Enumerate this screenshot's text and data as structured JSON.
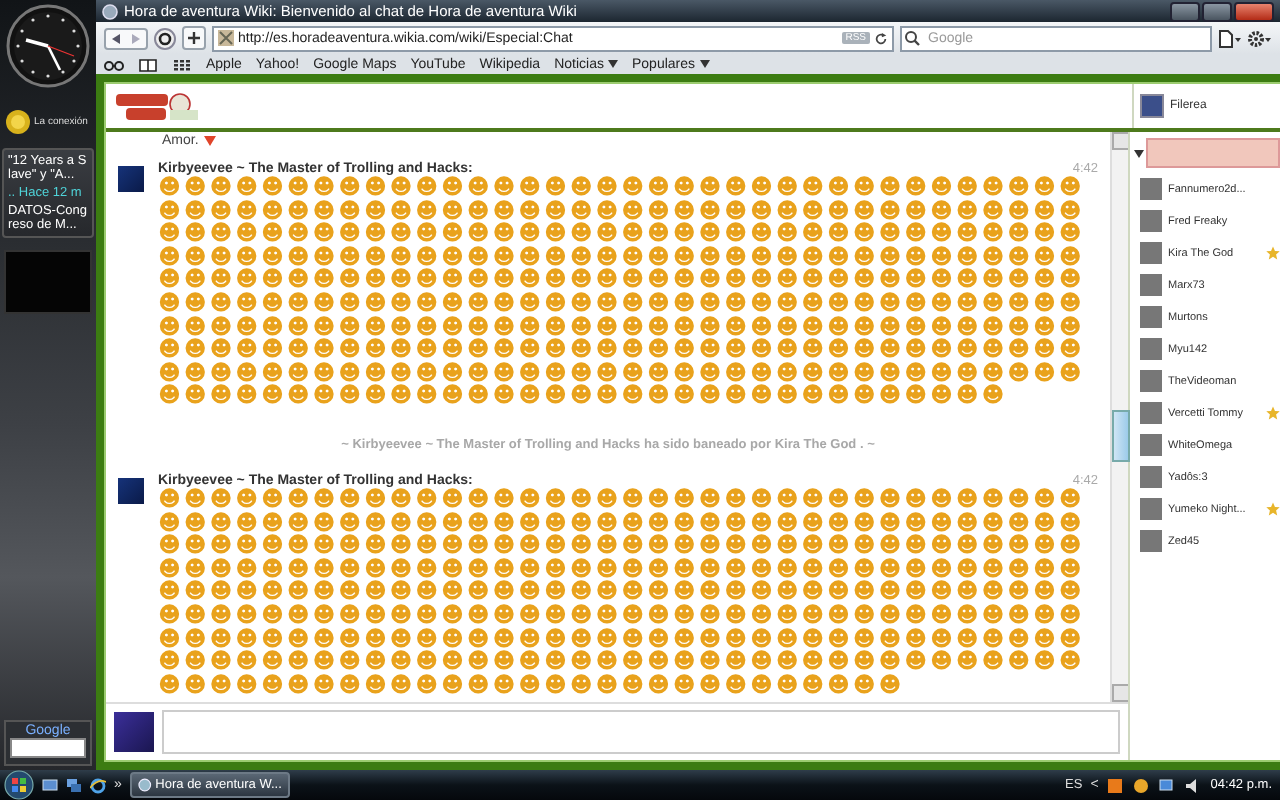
{
  "sidebar": {
    "weather": {
      "label": "La conexión"
    },
    "news": [
      {
        "headline": "\"12 Years a Slave\" y \"A...",
        "time": ".. Hace 12 m"
      },
      {
        "headline": "DATOS-Congreso de M..."
      }
    ],
    "google": {
      "label": "Google"
    }
  },
  "window": {
    "title": "Hora de aventura Wiki: Bienvenido al chat de Hora de aventura Wiki"
  },
  "toolbar": {
    "url": "http://es.horadeaventura.wikia.com/wiki/Especial:Chat",
    "rss": "RSS",
    "search": {
      "placeholder": "Google"
    }
  },
  "bookmarks": [
    {
      "label": "Apple",
      "menu": false
    },
    {
      "label": "Yahoo!",
      "menu": false
    },
    {
      "label": "Google Maps",
      "menu": false
    },
    {
      "label": "YouTube",
      "menu": false
    },
    {
      "label": "Wikipedia",
      "menu": false
    },
    {
      "label": "Noticias",
      "menu": true
    },
    {
      "label": "Populares",
      "menu": true
    }
  ],
  "chat": {
    "header": {
      "user": "Filerea"
    },
    "messages": [
      {
        "kind": "fragment",
        "text": "Amor."
      },
      {
        "kind": "message",
        "user": "Kirbyeevee ~ The Master of Trolling and Hacks:",
        "time": "4:42",
        "emoticons": "☻☻☻☻☻☻☻☻☻☻☻☻☻☻☻☻☻☻☻☻☻☻☻☻☻☻☻☻☻☻☻☻☻☻☻☻☻☻☻☻☻☻☻☻☻☻☻☻☻☻☻☻☻☻☻☻☻☻☻☻☻☻☻☻☻☻☻☻☻☻☻☻☻☻☻☻☻☻☻☻☻☻☻☻☻☻☻☻☻☻☻☻☻☻☻☻☻☻☻☻☻☻☻☻☻☻☻☻☻☻☻☻☻☻☻☻☻☻☻☻☻☻☻☻☻☻☻☻☻☻☻☻☻☻☻☻☻☻☻☻☻☻☻☻☻☻☻☻☻☻☻☻☻☻☻☻☻☻☻☻☻☻☻☻☻☻☻☻☻☻☻☻☻☻☻☻☻☻☻☻☻☻☻☻☻☻☻☻☻☻☻☻☻☻☻☻☻☻☻☻☻☻☻☻☻☻☻☻☻☻☻☻☻☻☻☻☻☻☻☻☻☻☻☻☻☻☻☻☻☻☻☻☻☻☻☻☻☻☻☻☻☻☻☻☻☻☻☻☻☻☻☻☻☻☻☻☻☻☻☻☻☻☻☻☻☻☻☻☻☻☻☻☻☻☻☻☻☻☻☻☻☻☻☻☻☻☻☻☻☻☻☻☻☻☻☻☻☻☻☻☻☻☻☻☻☻☻☻☻☻☻☻☻☻☻☻☻☻☻☻☻☻☻☻☻☻☻☻☻☻☻☻☻☻☻☻☻☻☻☻☻☻☻☻☻☻☻☻☻☻☻☻☻☻☻☻☻"
      },
      {
        "kind": "alert",
        "text": "~ Kirbyeevee ~ The Master of Trolling and Hacks ha sido baneado por Kira The God . ~"
      },
      {
        "kind": "message",
        "user": "Kirbyeevee ~ The Master of Trolling and Hacks:",
        "time": "4:42",
        "emoticons": "☻☻☻☻☻☻☻☻☻☻☻☻☻☻☻☻☻☻☻☻☻☻☻☻☻☻☻☻☻☻☻☻☻☻☻☻☻☻☻☻☻☻☻☻☻☻☻☻☻☻☻☻☻☻☻☻☻☻☻☻☻☻☻☻☻☻☻☻☻☻☻☻☻☻☻☻☻☻☻☻☻☻☻☻☻☻☻☻☻☻☻☻☻☻☻☻☻☻☻☻☻☻☻☻☻☻☻☻☻☻☻☻☻☻☻☻☻☻☻☻☻☻☻☻☻☻☻☻☻☻☻☻☻☻☻☻☻☻☻☻☻☻☻☻☻☻☻☻☻☻☻☻☻☻☻☻☻☻☻☻☻☻☻☻☻☻☻☻☻☻☻☻☻☻☻☻☻☻☻☻☻☻☻☻☻☻☻☻☻☻☻☻☻☻☻☻☻☻☻☻☻☻☻☻☻☻☻☻☻☻☻☻☻☻☻☻☻☻☻☻☻☻☻☻☻☻☻☻☻☻☻☻☻☻☻☻☻☻☻☻☻☻☻☻☻☻☻☻☻☻☻☻☻☻☻☻☻☻☻☻☻☻☻☻☻☻☻☻☻☻☻☻☻☻☻☻☻☻☻☻☻☻☻☻☻☻☻☻☻☻☻☻☻☻☻☻☻☻☻☻☻☻☻☻☻☻☻☻☻☻☻☻☻☻☻☻☻"
      }
    ],
    "users": [
      {
        "name": "Fannumero2d...",
        "star": false
      },
      {
        "name": "Fred Freaky",
        "star": false
      },
      {
        "name": "Kira The God",
        "star": true
      },
      {
        "name": "Marx73",
        "star": false
      },
      {
        "name": "Murtons",
        "star": false
      },
      {
        "name": "Myu142",
        "star": false
      },
      {
        "name": "TheVideoman",
        "star": false
      },
      {
        "name": "Vercetti Tommy",
        "star": true
      },
      {
        "name": "WhiteOmega",
        "star": false
      },
      {
        "name": "Yadôs:3",
        "star": false
      },
      {
        "name": "Yumeko Night...",
        "star": true
      },
      {
        "name": "Zed45",
        "star": false
      }
    ]
  },
  "taskbar": {
    "more": "»",
    "task": "Hora de aventura W...",
    "language": "ES",
    "expand": "<",
    "clock": "04:42 p.m."
  }
}
